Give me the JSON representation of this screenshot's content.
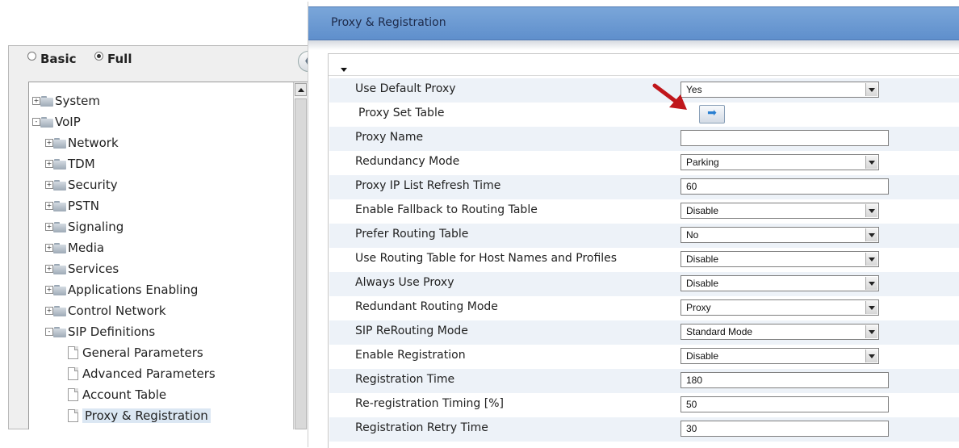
{
  "mode_selector": {
    "basic_label": "Basic",
    "full_label": "Full",
    "selected": "Full"
  },
  "nav_tree": {
    "items": [
      {
        "label": "System",
        "expander": "+"
      },
      {
        "label": "VoIP",
        "expander": "-"
      },
      {
        "label": "Network",
        "expander": "+"
      },
      {
        "label": "TDM",
        "expander": "+"
      },
      {
        "label": "Security",
        "expander": "+"
      },
      {
        "label": "PSTN",
        "expander": "+"
      },
      {
        "label": "Signaling",
        "expander": "+"
      },
      {
        "label": "Media",
        "expander": "+"
      },
      {
        "label": "Services",
        "expander": "+"
      },
      {
        "label": "Applications Enabling",
        "expander": "+"
      },
      {
        "label": "Control Network",
        "expander": "+"
      },
      {
        "label": "SIP Definitions",
        "expander": "-"
      },
      {
        "label": "General Parameters"
      },
      {
        "label": "Advanced Parameters"
      },
      {
        "label": "Account Table"
      },
      {
        "label": "Proxy & Registration",
        "selected": true
      }
    ]
  },
  "page": {
    "title": "Proxy & Registration"
  },
  "form": {
    "rows": [
      {
        "label": "Use Default Proxy",
        "type": "select",
        "value": "Yes"
      },
      {
        "label": "Proxy Set Table",
        "type": "button",
        "value": "➡"
      },
      {
        "label": "Proxy Name",
        "type": "text",
        "value": ""
      },
      {
        "label": "Redundancy Mode",
        "type": "select",
        "value": "Parking"
      },
      {
        "label": "Proxy IP List Refresh Time",
        "type": "text",
        "value": "60"
      },
      {
        "label": "Enable Fallback to Routing Table",
        "type": "select",
        "value": "Disable"
      },
      {
        "label": "Prefer Routing Table",
        "type": "select",
        "value": "No"
      },
      {
        "label": "Use Routing Table for Host Names and Profiles",
        "type": "select",
        "value": "Disable"
      },
      {
        "label": "Always Use Proxy",
        "type": "select",
        "value": "Disable"
      },
      {
        "label": "Redundant Routing Mode",
        "type": "select",
        "value": "Proxy"
      },
      {
        "label": "SIP ReRouting Mode",
        "type": "select",
        "value": "Standard Mode"
      },
      {
        "label": "Enable Registration",
        "type": "select",
        "value": "Disable"
      },
      {
        "label": "Registration Time",
        "type": "text",
        "value": "180"
      },
      {
        "label": "Re-registration Timing [%]",
        "type": "text",
        "value": "50"
      },
      {
        "label": "Registration Retry Time",
        "type": "text",
        "value": "30"
      }
    ]
  },
  "colors": {
    "title_bar": "#6d9bd3",
    "row_alt": "#edf2f8",
    "annotation_arrow": "#c0161b"
  },
  "icons": {
    "folder": "folder-icon",
    "page": "page-icon",
    "collapse": "collapse-panel-icon",
    "annotation": "red-arrow-annotation"
  }
}
